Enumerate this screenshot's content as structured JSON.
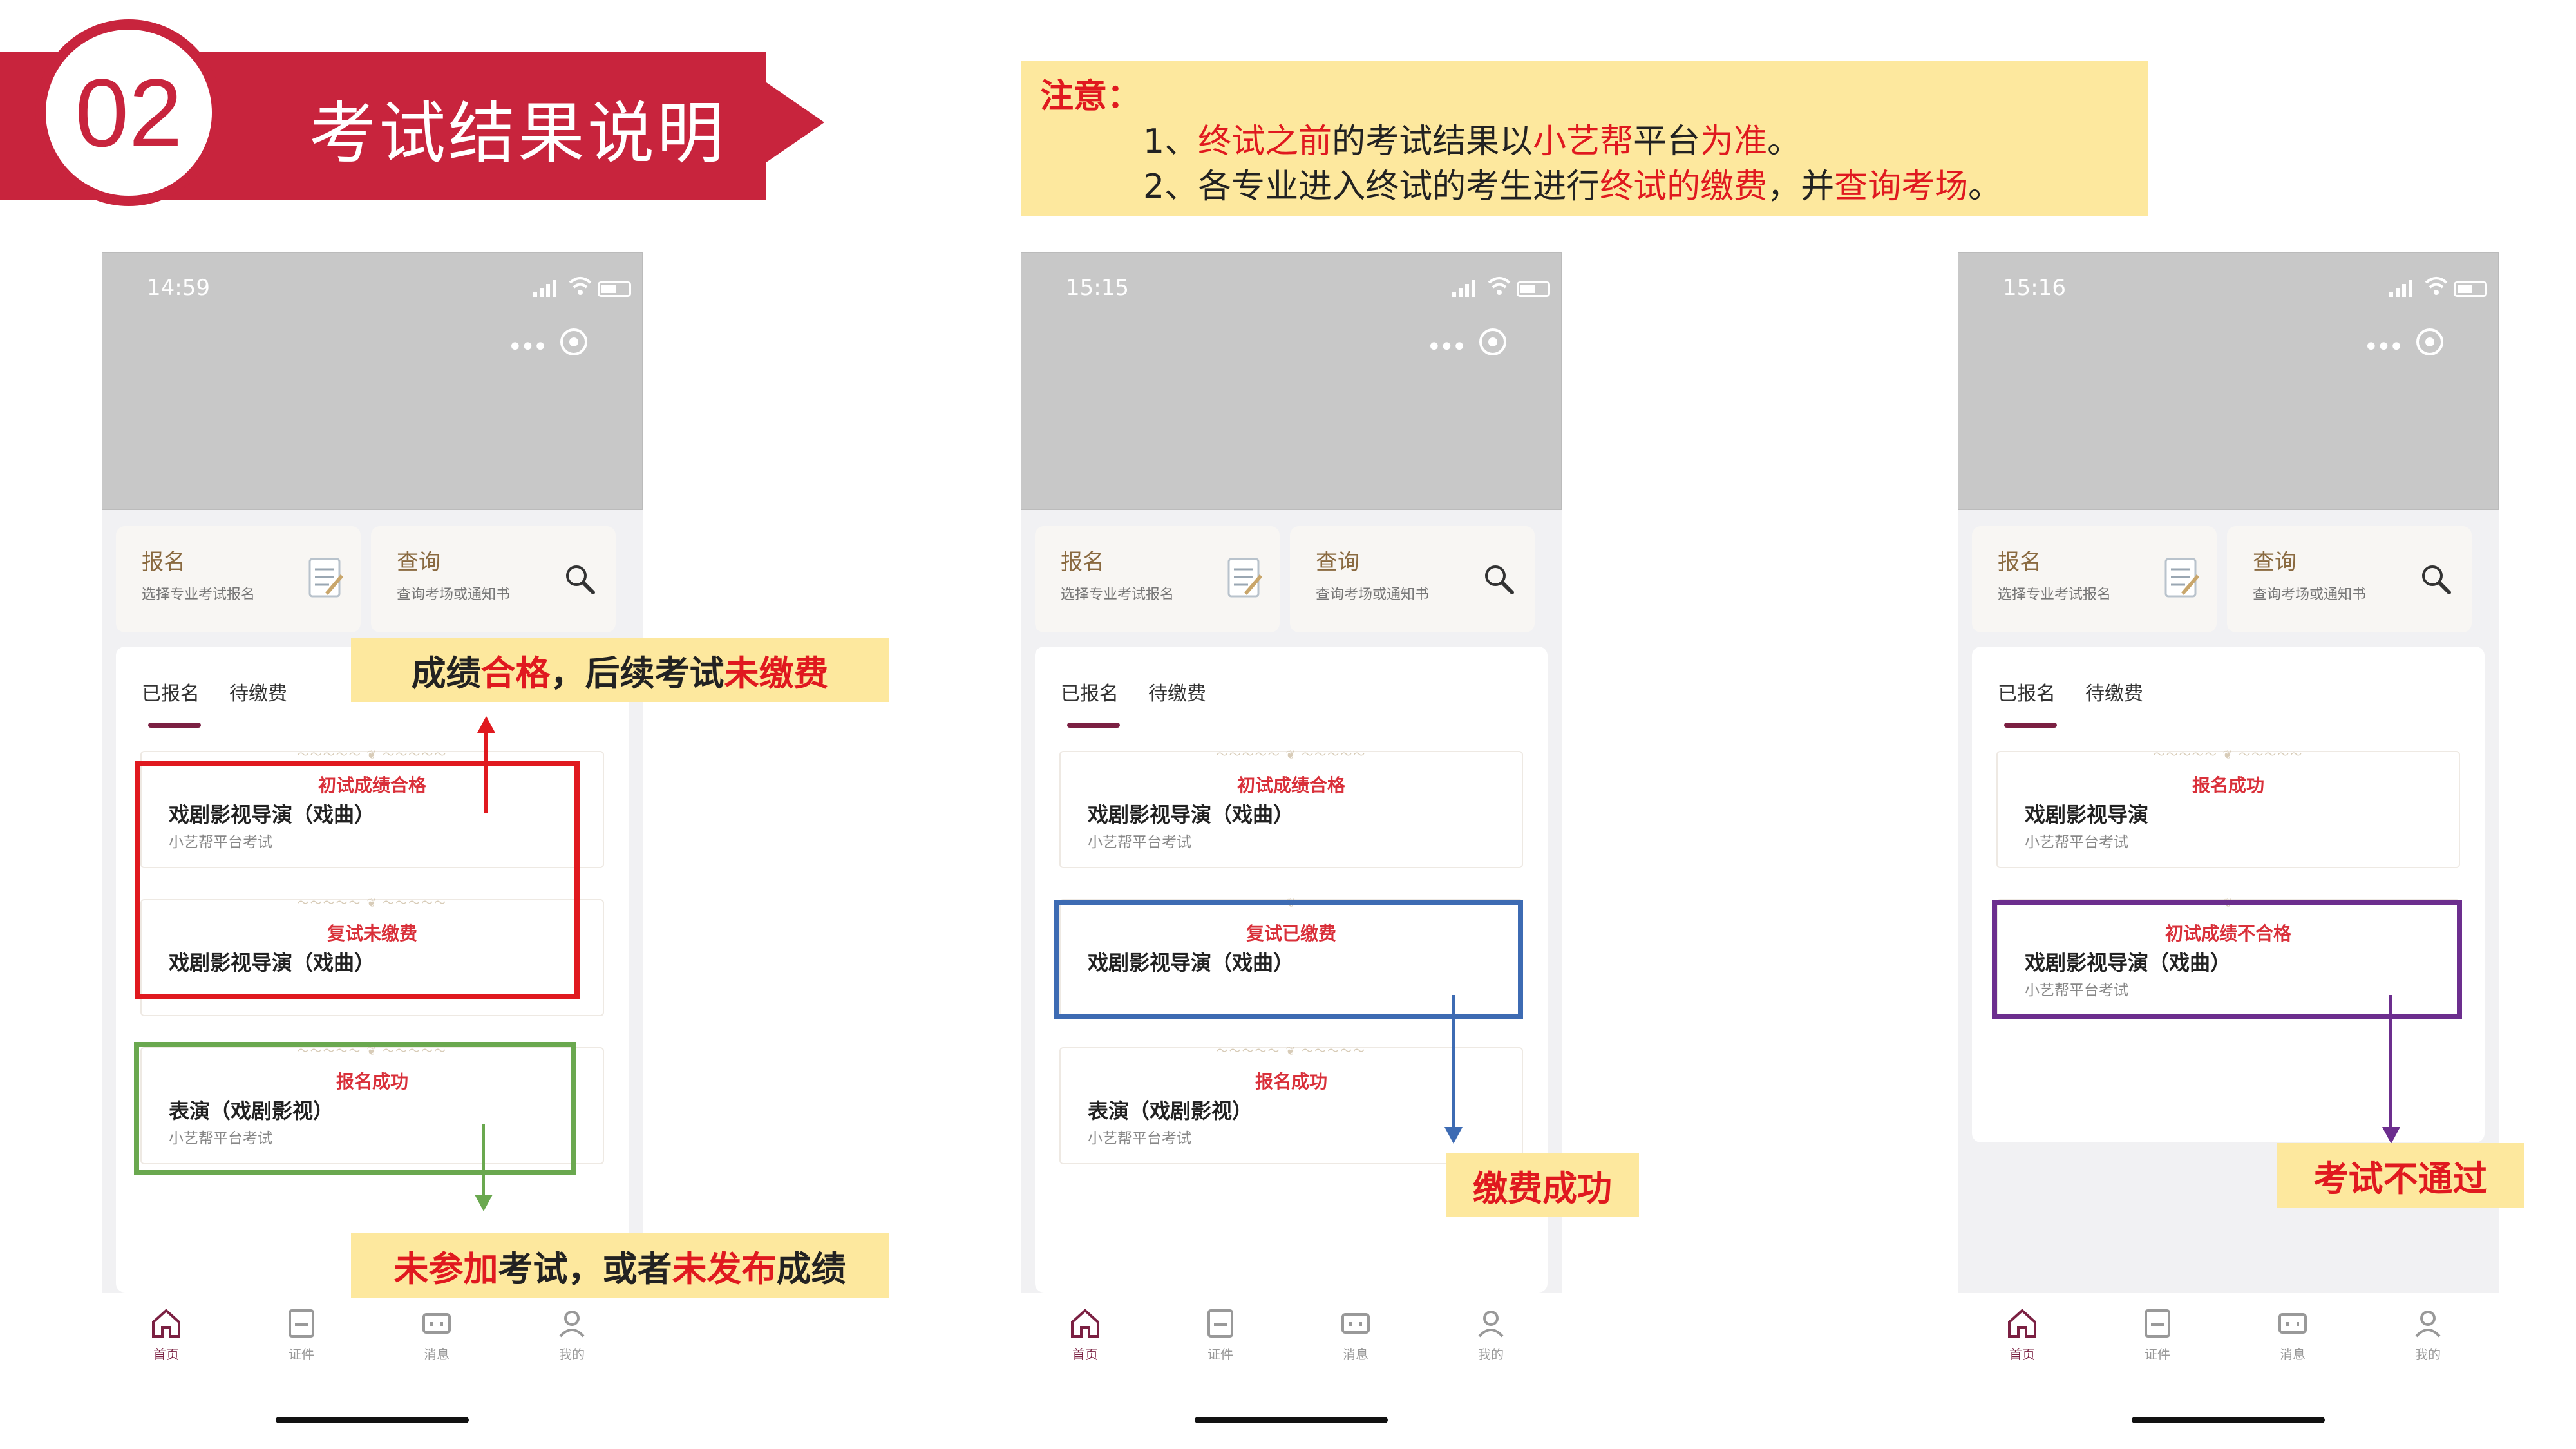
{
  "header": {
    "number": "02",
    "title": "考试结果说明"
  },
  "notice": {
    "title": "注意：",
    "line1": {
      "prefix": "1、",
      "red1": "终试之前",
      "mid1": "的考试结果以",
      "red2": "小艺帮",
      "mid2": "平台",
      "red3": "为准",
      "end": "。"
    },
    "line2": {
      "prefix": "2、各专业进入终试的考生进行",
      "red1": "终试的缴费",
      "mid1": "，并",
      "red2": "查询考场",
      "end": "。"
    }
  },
  "phones": [
    {
      "time": "14:59"
    },
    {
      "time": "15:15"
    },
    {
      "time": "15:16"
    }
  ],
  "cards": {
    "signup": {
      "title": "报名",
      "sub": "选择专业考试报名"
    },
    "query": {
      "title": "查询",
      "sub": "查询考场或通知书"
    }
  },
  "tabs": {
    "registered": "已报名",
    "pending": "待缴费"
  },
  "entries": {
    "p1": [
      {
        "status": "初试成绩合格",
        "name": "戏剧影视导演（戏曲）",
        "source": "小艺帮平台考试"
      },
      {
        "status": "复试未缴费",
        "name": "戏剧影视导演（戏曲）",
        "source": ""
      },
      {
        "status": "报名成功",
        "name": "表演（戏剧影视）",
        "source": "小艺帮平台考试"
      }
    ],
    "p2": [
      {
        "status": "初试成绩合格",
        "name": "戏剧影视导演（戏曲）",
        "source": "小艺帮平台考试"
      },
      {
        "status": "复试已缴费",
        "name": "戏剧影视导演（戏曲）",
        "source": ""
      },
      {
        "status": "报名成功",
        "name": "表演（戏剧影视）",
        "source": "小艺帮平台考试"
      }
    ],
    "p3": [
      {
        "status": "报名成功",
        "name": "戏剧影视导演",
        "source": "小艺帮平台考试"
      },
      {
        "status": "初试成绩不合格",
        "name": "戏剧影视导演（戏曲）",
        "source": "小艺帮平台考试"
      }
    ]
  },
  "nav": {
    "home": "首页",
    "cert": "证件",
    "msg": "消息",
    "mine": "我的"
  },
  "callouts": {
    "c1": {
      "a": "成绩",
      "b": "合格",
      "c": "，后续考试",
      "d": "未缴费"
    },
    "c2": {
      "a": "未参加",
      "b": "考试，或者",
      "c": "未发布",
      "d": "成绩"
    },
    "c3": "缴费成功",
    "c4": "考试不通过"
  },
  "colors": {
    "brand": "#c8243d",
    "red_box": "#e0191f",
    "green_box": "#6aa84f",
    "blue_box": "#3d6bb3",
    "purple_box": "#6c2e8e",
    "callout_bg": "#fde89e"
  }
}
